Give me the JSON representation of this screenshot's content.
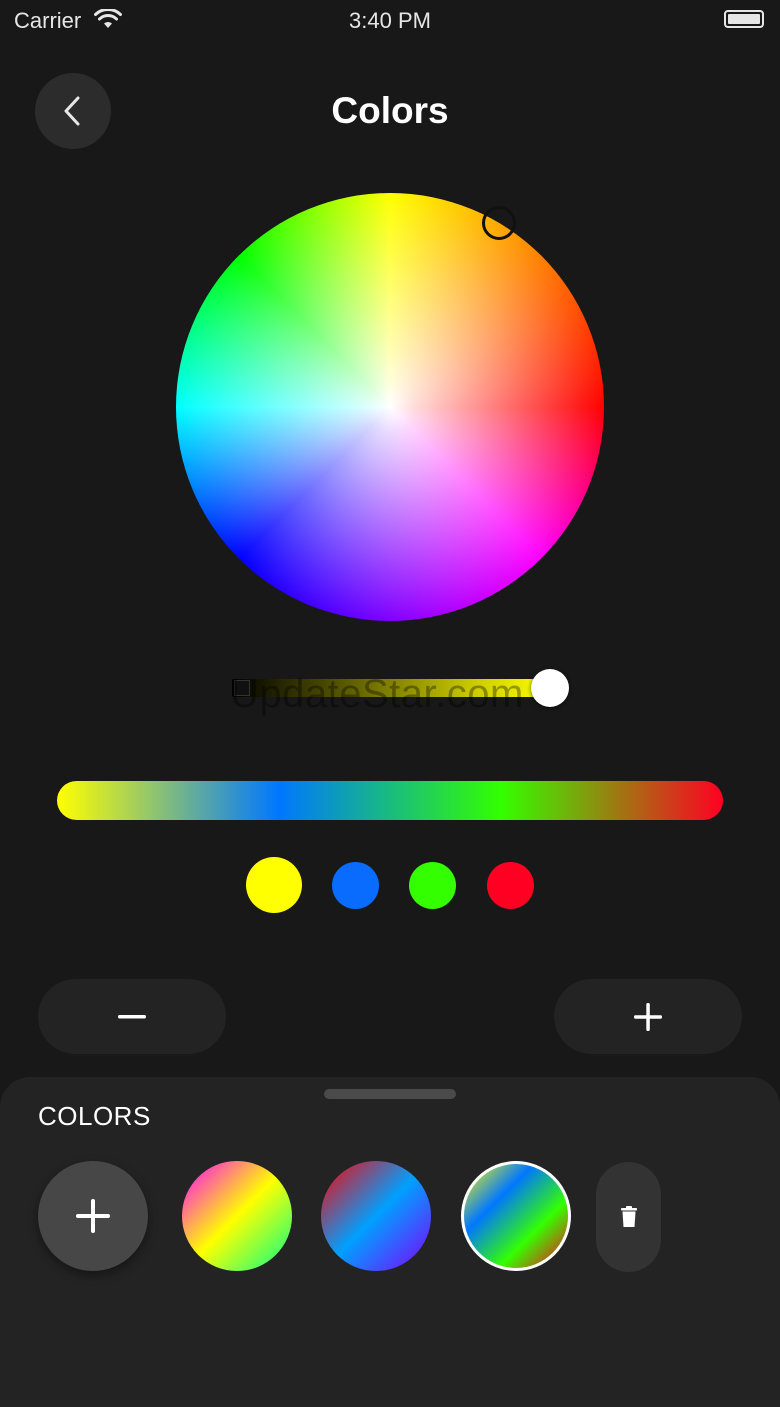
{
  "status_bar": {
    "carrier": "Carrier",
    "time": "3:40 PM",
    "icons": [
      "wifi-icon",
      "battery-icon"
    ]
  },
  "header": {
    "title": "Colors",
    "back_icon": "chevron-left-icon"
  },
  "color_wheel": {
    "selected_hex": "#ffff00"
  },
  "brightness": {
    "value_fraction": 1.0
  },
  "watermark": "UpdateStar.com",
  "gradient_stops": [
    "#ffff00",
    "#0077ff",
    "#33ff00",
    "#ff0022"
  ],
  "swatches": [
    {
      "color": "#ffff00",
      "selected": true
    },
    {
      "color": "#0a6cff",
      "selected": false
    },
    {
      "color": "#33ff00",
      "selected": false
    },
    {
      "color": "#ff0022",
      "selected": false
    }
  ],
  "stepper": {
    "decrease_icon": "minus-icon",
    "increase_icon": "plus-icon"
  },
  "presets_sheet": {
    "title": "COLORS",
    "add_icon": "plus-icon",
    "delete_icon": "trash-icon",
    "presets": [
      {
        "colors": [
          "#ff00ff",
          "#ffff00",
          "#00ff88"
        ],
        "selected": false
      },
      {
        "colors": [
          "#ff0000",
          "#00a0ff",
          "#8000ff"
        ],
        "selected": false
      },
      {
        "colors": [
          "#ffff00",
          "#0077ff",
          "#33ff00",
          "#ff0022"
        ],
        "selected": true
      }
    ]
  }
}
